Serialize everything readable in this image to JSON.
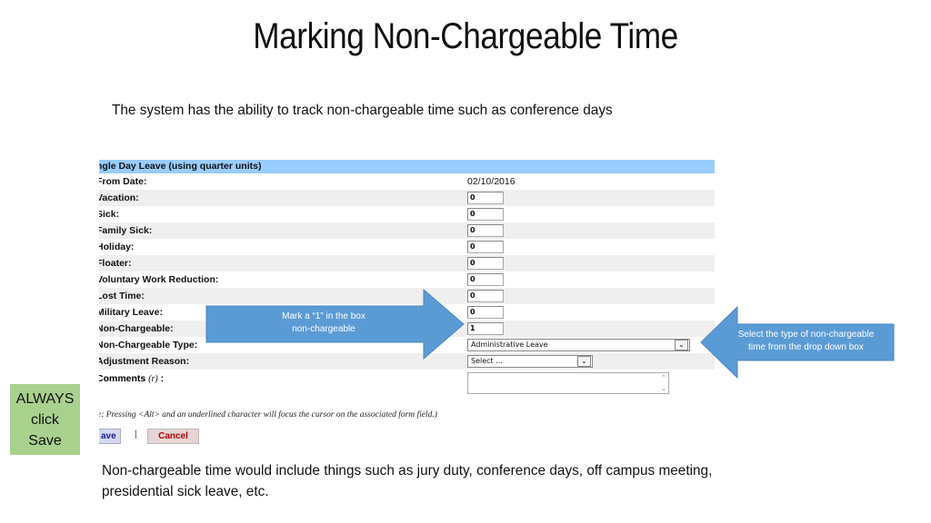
{
  "slide": {
    "title": "Marking Non-Chargeable Time",
    "intro": "The system has the ability to track non-chargeable time such as conference days",
    "footer": "Non-chargeable time would include things such as jury duty, conference days, off campus meeting, presidential sick leave, etc."
  },
  "form": {
    "header": "ngle Day Leave (using quarter units)",
    "rows": [
      {
        "label": "From Date:",
        "value": "02/10/2016"
      },
      {
        "label": "Vacation:",
        "value": "0"
      },
      {
        "label": "Sick:",
        "value": "0"
      },
      {
        "label": "Family Sick:",
        "value": "0"
      },
      {
        "label": "Holiday:",
        "value": "0"
      },
      {
        "label": "Floater:",
        "value": "0"
      },
      {
        "label": "Voluntary Work Reduction:",
        "value": "0"
      },
      {
        "label": "Lost Time:",
        "value": "0"
      },
      {
        "label": "Military Leave:",
        "value": "0"
      },
      {
        "label": "Non-Chargeable:",
        "value": "1"
      },
      {
        "label": "Non-Chargeable Type:",
        "value": "Administrative Leave"
      },
      {
        "label": "Adjustment Reason:",
        "value": "Select ..."
      }
    ],
    "comments_label": "Comments",
    "comments_hint": "(r)",
    "comments_value": "",
    "hint": "e: Pressing <Alt> and an underlined character will focus the cursor on the associated form field.)",
    "save_label": "ave",
    "separator": "|",
    "cancel_label": "Cancel"
  },
  "callouts": {
    "right_arrow": {
      "line1": "Mark a “1” in the box",
      "line2": "non-chargeable",
      "color": "#5b9bd5"
    },
    "left_arrow": {
      "line1": "Select the type of non-chargeable",
      "line2": "time from the drop down box",
      "color": "#5b9bd5"
    },
    "always_box": {
      "line1": "ALWAYS",
      "line2": "click",
      "line3": "Save",
      "color": "#a9d18e"
    }
  }
}
